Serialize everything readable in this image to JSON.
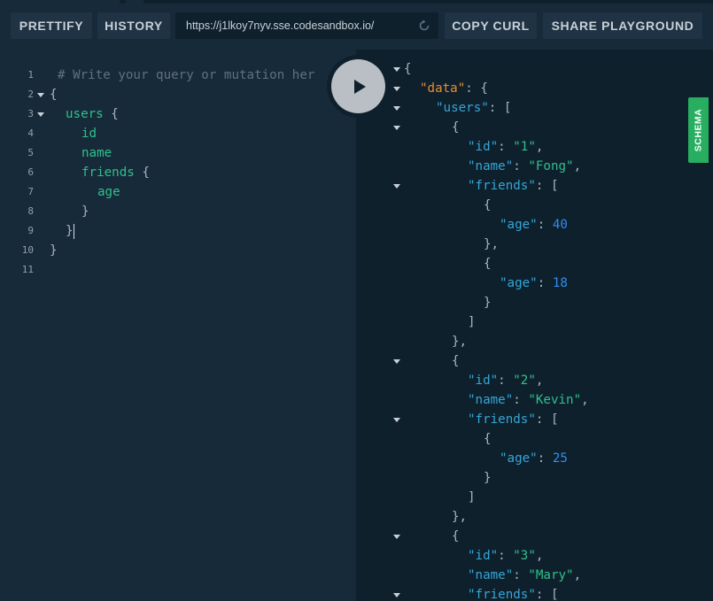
{
  "toolbar": {
    "prettify_label": "PRETTIFY",
    "history_label": "HISTORY",
    "endpoint_url": "https://j1lkoy7nyv.sse.codesandbox.io/",
    "copy_curl_label": "COPY CURL",
    "share_label": "SHARE PLAYGROUND"
  },
  "schema_tab": {
    "label": "SCHEMA"
  },
  "query_editor": {
    "line_numbers": [
      "1",
      "2",
      "3",
      "4",
      "5",
      "6",
      "7",
      "8",
      "9",
      "10",
      "11"
    ],
    "comment": "# Write your query or mutation her",
    "open_brace": "{",
    "close_brace": "}",
    "users_field": "users",
    "id_field": "id",
    "name_field": "name",
    "friends_field": "friends",
    "age_field": "age"
  },
  "result": {
    "data_key": "\"data\"",
    "users_key": "\"users\"",
    "id_key": "\"id\"",
    "name_key": "\"name\"",
    "friends_key": "\"friends\"",
    "age_key": "\"age\"",
    "users": [
      {
        "id": "\"1\"",
        "name": "\"Fong\"",
        "ages": [
          "40",
          "18"
        ]
      },
      {
        "id": "\"2\"",
        "name": "\"Kevin\"",
        "ages": [
          "25"
        ]
      },
      {
        "id": "\"3\"",
        "name": "\"Mary\""
      }
    ]
  },
  "colors": {
    "background": "#172a3a",
    "result_background": "#0f202d",
    "field_green": "#2ec08b",
    "key_blue": "#34a6d6",
    "number_blue": "#2e8ff0",
    "data_orange": "#e88e2a",
    "schema_green": "#27ae60"
  }
}
